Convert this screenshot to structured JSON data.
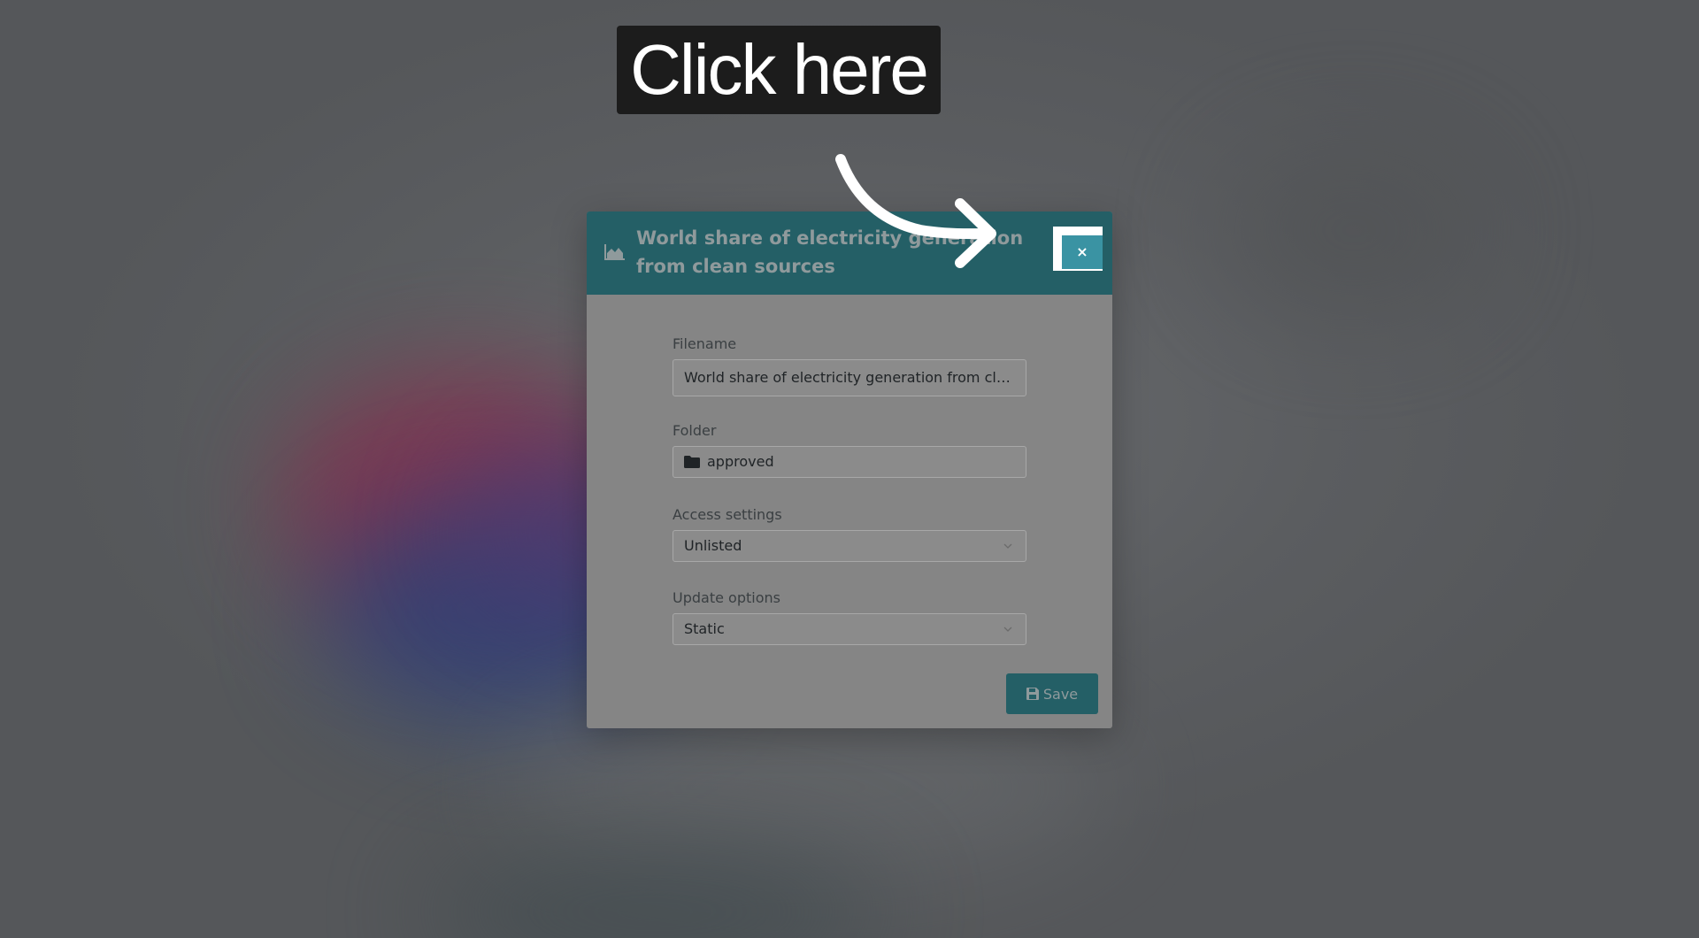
{
  "callout": {
    "text": "Click here"
  },
  "modal": {
    "title": "World share of electricity generation from clean sources",
    "header_icon": "area-chart-icon",
    "close_label": "×",
    "fields": {
      "filename": {
        "label": "Filename",
        "value": "World share of electricity generation from clean sources"
      },
      "folder": {
        "label": "Folder",
        "value": "approved",
        "icon": "folder-icon"
      },
      "access": {
        "label": "Access settings",
        "value": "Unlisted"
      },
      "update": {
        "label": "Update options",
        "value": "Static"
      }
    },
    "save_label": "Save",
    "save_icon": "floppy-disk-icon"
  },
  "colors": {
    "header": "#245f66",
    "close_button": "#3a93a3",
    "callout_bg": "#1c1c1c"
  }
}
